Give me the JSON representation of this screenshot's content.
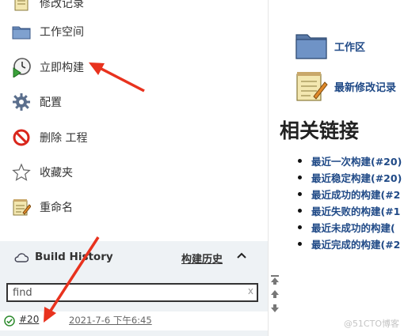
{
  "sidebar": {
    "tasks": [
      {
        "id": "changes",
        "label": "修改记录",
        "icon": "notepad-icon"
      },
      {
        "id": "workspace",
        "label": "工作空间",
        "icon": "folder-icon"
      },
      {
        "id": "build-now",
        "label": "立即构建",
        "icon": "clock-play-icon"
      },
      {
        "id": "configure",
        "label": "配置",
        "icon": "gear-icon"
      },
      {
        "id": "delete",
        "label": "删除 工程",
        "icon": "no-entry-icon"
      },
      {
        "id": "favorite",
        "label": "收藏夹",
        "icon": "star-icon"
      },
      {
        "id": "rename",
        "label": "重命名",
        "icon": "notepad-pencil-icon"
      }
    ]
  },
  "build_history": {
    "title": "Build History",
    "trend_label": "构建历史",
    "search_value": "find",
    "clear_glyph": "x",
    "builds": [
      {
        "number": "#20",
        "date": "2021-7-6 下午6:45",
        "status": "success"
      }
    ]
  },
  "main": {
    "workspace_link": "工作区",
    "changes_link": "最新修改记录",
    "related_title": "相关链接",
    "related_links": [
      "最近一次构建(#20)",
      "最近稳定构建(#20)",
      "最近成功的构建(#2",
      "最近失败的构建(#1",
      "最近未成功的构建(",
      "最近完成的构建(#2"
    ]
  },
  "watermark": "@51CTO博客",
  "colors": {
    "link": "#204a87",
    "panel": "#eef2f5",
    "annotation": "#e8321e",
    "success": "#2e8b2e"
  }
}
